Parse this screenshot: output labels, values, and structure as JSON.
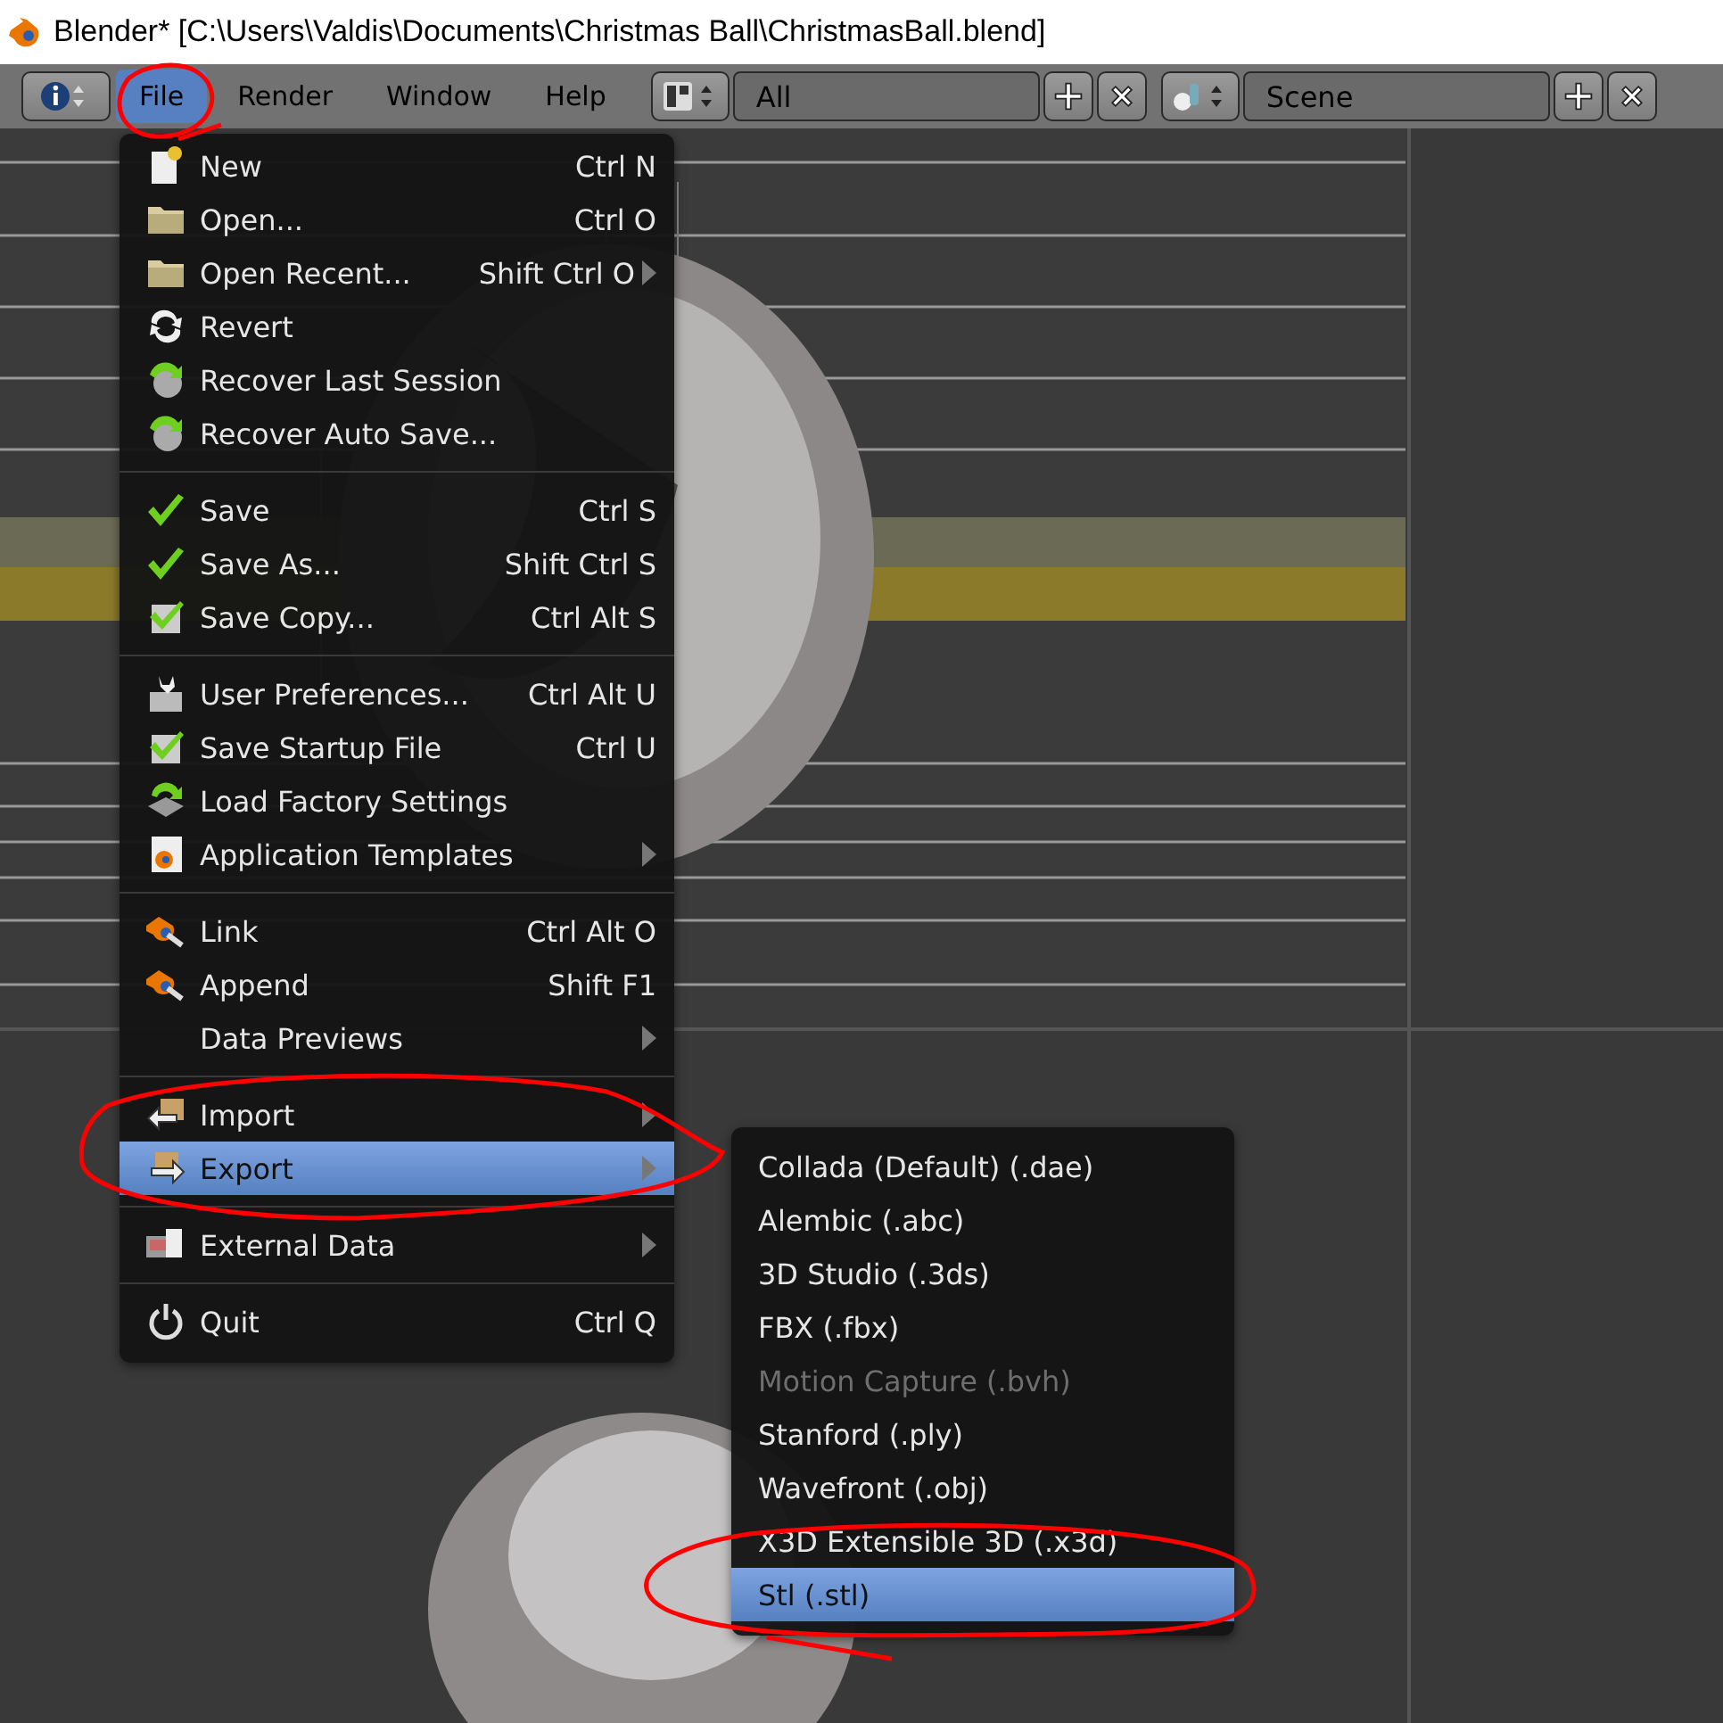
{
  "window": {
    "title": "Blender* [C:\\Users\\Valdis\\Documents\\Christmas Ball\\ChristmasBall.blend]"
  },
  "header": {
    "menus": [
      {
        "label": "File",
        "selected": true
      },
      {
        "label": "Render",
        "selected": false
      },
      {
        "label": "Window",
        "selected": false
      },
      {
        "label": "Help",
        "selected": false
      }
    ],
    "layout": {
      "value": "All"
    },
    "scene": {
      "value": "Scene"
    }
  },
  "file_menu": {
    "groups": [
      {
        "items": [
          {
            "label": "New",
            "shortcut": "Ctrl N",
            "kind": "new",
            "submenu": false,
            "selected": false
          },
          {
            "label": "Open...",
            "shortcut": "Ctrl O",
            "kind": "folder",
            "submenu": false,
            "selected": false
          },
          {
            "label": "Open Recent...",
            "shortcut": "Shift Ctrl O",
            "kind": "folder",
            "submenu": true,
            "selected": false
          },
          {
            "label": "Revert",
            "kind": "revert",
            "submenu": false,
            "selected": false
          },
          {
            "label": "Recover Last Session",
            "kind": "recover",
            "submenu": false,
            "selected": false
          },
          {
            "label": "Recover Auto Save...",
            "kind": "recover",
            "submenu": false,
            "selected": false
          }
        ]
      },
      {
        "items": [
          {
            "label": "Save",
            "shortcut": "Ctrl S",
            "kind": "check",
            "submenu": false,
            "selected": false
          },
          {
            "label": "Save As...",
            "shortcut": "Shift Ctrl S",
            "kind": "check",
            "submenu": false,
            "selected": false
          },
          {
            "label": "Save Copy...",
            "shortcut": "Ctrl Alt S",
            "kind": "checkdoc",
            "submenu": false,
            "selected": false
          }
        ]
      },
      {
        "items": [
          {
            "label": "User Preferences...",
            "shortcut": "Ctrl Alt U",
            "kind": "prefs",
            "submenu": false,
            "selected": false
          },
          {
            "label": "Save Startup File",
            "shortcut": "Ctrl U",
            "kind": "checkdoc",
            "submenu": false,
            "selected": false
          },
          {
            "label": "Load Factory Settings",
            "kind": "factory",
            "submenu": false,
            "selected": false
          },
          {
            "label": "Application Templates",
            "kind": "template",
            "submenu": true,
            "selected": false
          }
        ]
      },
      {
        "items": [
          {
            "label": "Link",
            "shortcut": "Ctrl Alt O",
            "kind": "link",
            "submenu": false,
            "selected": false
          },
          {
            "label": "Append",
            "shortcut": "Shift F1",
            "kind": "link",
            "submenu": false,
            "selected": false
          },
          {
            "label": "Data Previews",
            "submenu": true,
            "selected": false
          }
        ]
      },
      {
        "items": [
          {
            "label": "Import",
            "kind": "import",
            "submenu": true,
            "selected": false
          },
          {
            "label": "Export",
            "kind": "export",
            "submenu": true,
            "selected": true
          }
        ]
      },
      {
        "items": [
          {
            "label": "External Data",
            "kind": "external",
            "submenu": true,
            "selected": false
          }
        ]
      },
      {
        "items": [
          {
            "label": "Quit",
            "shortcut": "Ctrl Q",
            "kind": "power",
            "submenu": false,
            "selected": false
          }
        ]
      }
    ]
  },
  "export_menu": {
    "items": [
      {
        "label": "Collada (Default) (.dae)",
        "selected": false,
        "disabled": false
      },
      {
        "label": "Alembic (.abc)",
        "selected": false,
        "disabled": false
      },
      {
        "label": "3D Studio (.3ds)",
        "selected": false,
        "disabled": false
      },
      {
        "label": "FBX (.fbx)",
        "selected": false,
        "disabled": false
      },
      {
        "label": "Motion Capture (.bvh)",
        "selected": false,
        "disabled": true
      },
      {
        "label": "Stanford (.ply)",
        "selected": false,
        "disabled": false
      },
      {
        "label": "Wavefront (.obj)",
        "selected": false,
        "disabled": false
      },
      {
        "label": "X3D Extensible 3D (.x3d)",
        "selected": false,
        "disabled": false
      },
      {
        "label": "Stl (.stl)",
        "selected": true,
        "disabled": false
      }
    ]
  }
}
